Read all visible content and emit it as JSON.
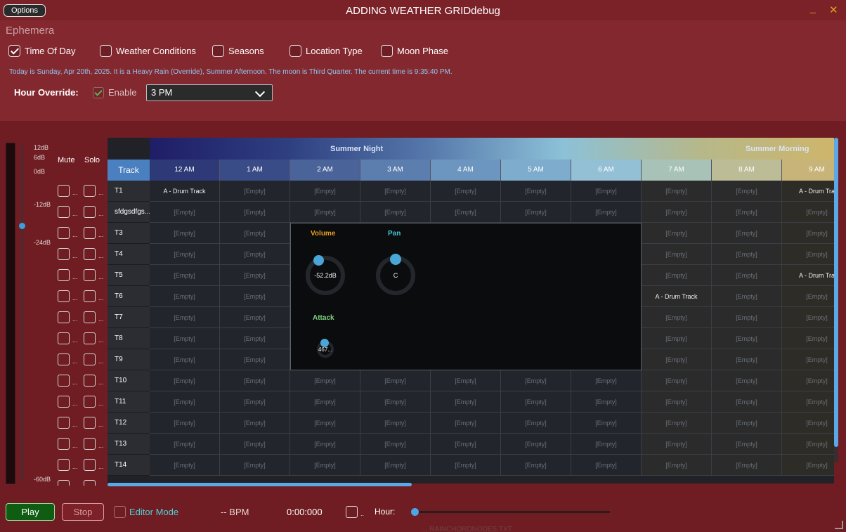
{
  "window": {
    "title": "ADDING WEATHER GRIDdebug",
    "options_label": "Options",
    "minimize_glyph": "_",
    "close_glyph": "✕"
  },
  "header": {
    "app_name": "Ephemera",
    "toggles": [
      {
        "label": "Time Of Day",
        "checked": true
      },
      {
        "label": "Weather Conditions",
        "checked": false
      },
      {
        "label": "Seasons",
        "checked": false
      },
      {
        "label": "Location Type",
        "checked": false
      },
      {
        "label": "Moon Phase",
        "checked": false
      }
    ],
    "status_text": "Today is Sunday, Apr 20th, 2025. It is a Heavy Rain (Override), Summer Afternoon. The moon is Third Quarter. The current time is 9:35:40 PM.",
    "hour_override": {
      "label": "Hour Override:",
      "enable_label": "Enable",
      "enabled": true,
      "selected": "3 PM"
    }
  },
  "mixer": {
    "db_labels": [
      "12dB",
      "6dB",
      "0dB",
      "-12dB",
      "-24dB",
      "-60dB"
    ],
    "mute_label": "Mute",
    "solo_label": "Solo",
    "dots": "..."
  },
  "grid": {
    "seasons": [
      {
        "label": "Summer Night"
      },
      {
        "label": "Summer Morning"
      }
    ],
    "track_header": "Track",
    "hours": [
      "12 AM",
      "1 AM",
      "2 AM",
      "3 AM",
      "4 AM",
      "5 AM",
      "6 AM",
      "7 AM",
      "8 AM",
      "9 AM"
    ],
    "empty_text": "[Empty]",
    "tracks": [
      {
        "name": "T1",
        "cells": [
          "A - Drum Track",
          "",
          "",
          "",
          "",
          "",
          "",
          "",
          "",
          "A - Drum Tra"
        ]
      },
      {
        "name": "sfdgsdfgs...",
        "cells": [
          "",
          "",
          "",
          "",
          "",
          "",
          "",
          "",
          "",
          ""
        ]
      },
      {
        "name": "T3",
        "cells": [
          "",
          "",
          "",
          "",
          "",
          "",
          "",
          "",
          "",
          ""
        ]
      },
      {
        "name": "T4",
        "cells": [
          "",
          "",
          "",
          "",
          "",
          "",
          "",
          "",
          "",
          ""
        ]
      },
      {
        "name": "T5",
        "cells": [
          "",
          "",
          "",
          "",
          "",
          "",
          "",
          "",
          "",
          "A - Drum Tra"
        ]
      },
      {
        "name": "T6",
        "cells": [
          "",
          "",
          "",
          "",
          "",
          "",
          "",
          "A - Drum Track",
          "",
          ""
        ]
      },
      {
        "name": "T7",
        "cells": [
          "",
          "",
          "",
          "",
          "",
          "",
          "",
          "",
          "",
          ""
        ]
      },
      {
        "name": "T8",
        "cells": [
          "",
          "",
          "",
          "",
          "",
          "",
          "",
          "",
          "",
          ""
        ]
      },
      {
        "name": "T9",
        "cells": [
          "",
          "",
          "",
          "",
          "",
          "",
          "",
          "",
          "",
          ""
        ]
      },
      {
        "name": "T10",
        "cells": [
          "",
          "",
          "",
          "",
          "",
          "",
          "",
          "",
          "",
          ""
        ]
      },
      {
        "name": "T11",
        "cells": [
          "",
          "",
          "",
          "",
          "",
          "",
          "",
          "",
          "",
          ""
        ]
      },
      {
        "name": "T12",
        "cells": [
          "",
          "",
          "",
          "",
          "",
          "",
          "",
          "",
          "",
          ""
        ]
      },
      {
        "name": "T13",
        "cells": [
          "",
          "",
          "",
          "",
          "",
          "",
          "",
          "",
          "",
          ""
        ]
      },
      {
        "name": "T14",
        "cells": [
          "",
          "",
          "",
          "",
          "",
          "",
          "",
          "",
          "",
          ""
        ]
      }
    ]
  },
  "popup": {
    "volume": {
      "title": "Volume",
      "value": "-52.2dB",
      "color": "#e8a020"
    },
    "pan": {
      "title": "Pan",
      "value": "C",
      "color": "#3fc7d6"
    },
    "attack": {
      "title": "Attack",
      "value": "467...",
      "color": "#7fd07f"
    }
  },
  "footer": {
    "play_label": "Play",
    "stop_label": "Stop",
    "editor_mode_label": "Editor Mode",
    "bpm_text": "-- BPM",
    "time_text": "0:00:000",
    "dot_text": "..",
    "hour_label": "Hour:",
    "taskbar_peek": "... RAINCHORDNODES.TXT"
  },
  "colors": {
    "accent": "#4aa6e6",
    "background": "#7d252c",
    "grid_bg": "#202228"
  }
}
